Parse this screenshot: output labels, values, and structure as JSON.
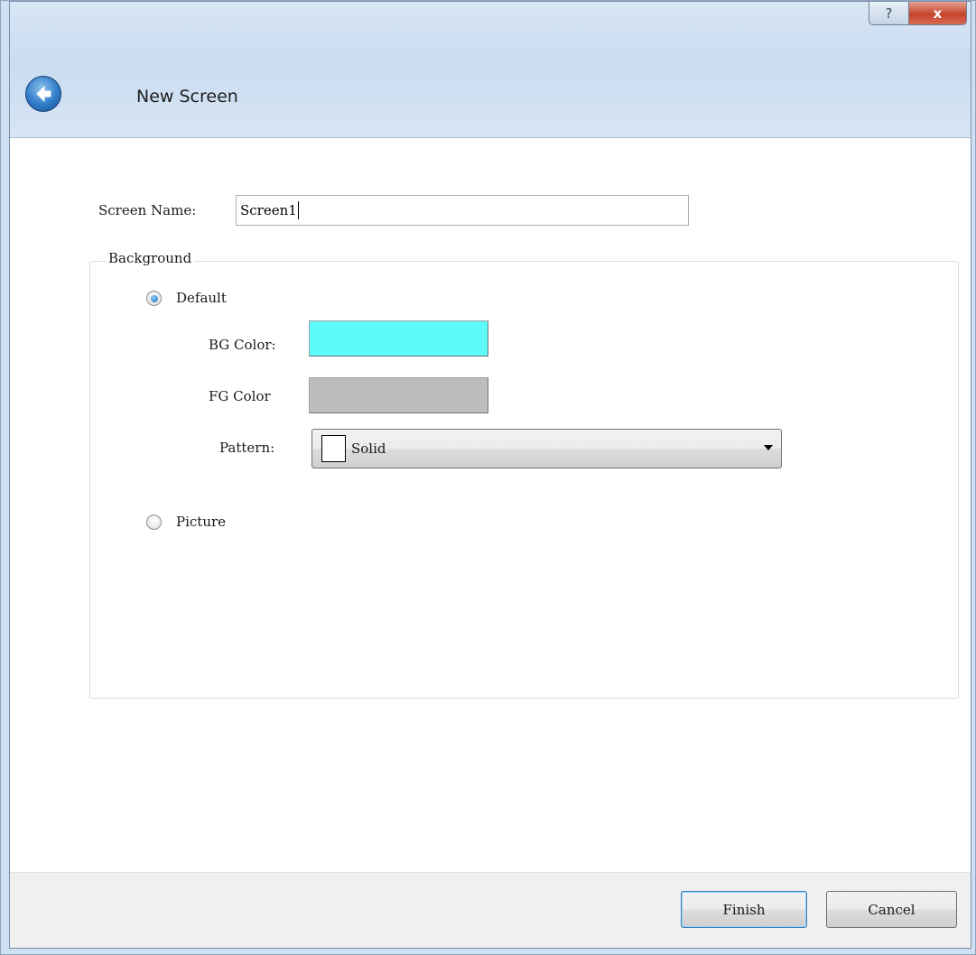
{
  "window": {
    "title": "New Screen",
    "help_glyph": "?",
    "close_glyph": "x"
  },
  "form": {
    "screen_name_label": "Screen Name:",
    "screen_name_value": "Screen1"
  },
  "background": {
    "group_label": "Background",
    "default_option_label": "Default",
    "default_selected": true,
    "bg_color_label": "BG Color:",
    "bg_color_value": "#5ffbfb",
    "fg_color_label": "FG Color",
    "fg_color_value": "#bdbdbd",
    "pattern_label": "Pattern:",
    "pattern_value": "Solid",
    "picture_option_label": "Picture",
    "picture_selected": false
  },
  "footer": {
    "finish_label": "Finish",
    "cancel_label": "Cancel"
  },
  "icons": {
    "back": "back-arrow-icon",
    "help": "help-icon",
    "close": "close-icon",
    "dropdown": "chevron-down-icon"
  }
}
